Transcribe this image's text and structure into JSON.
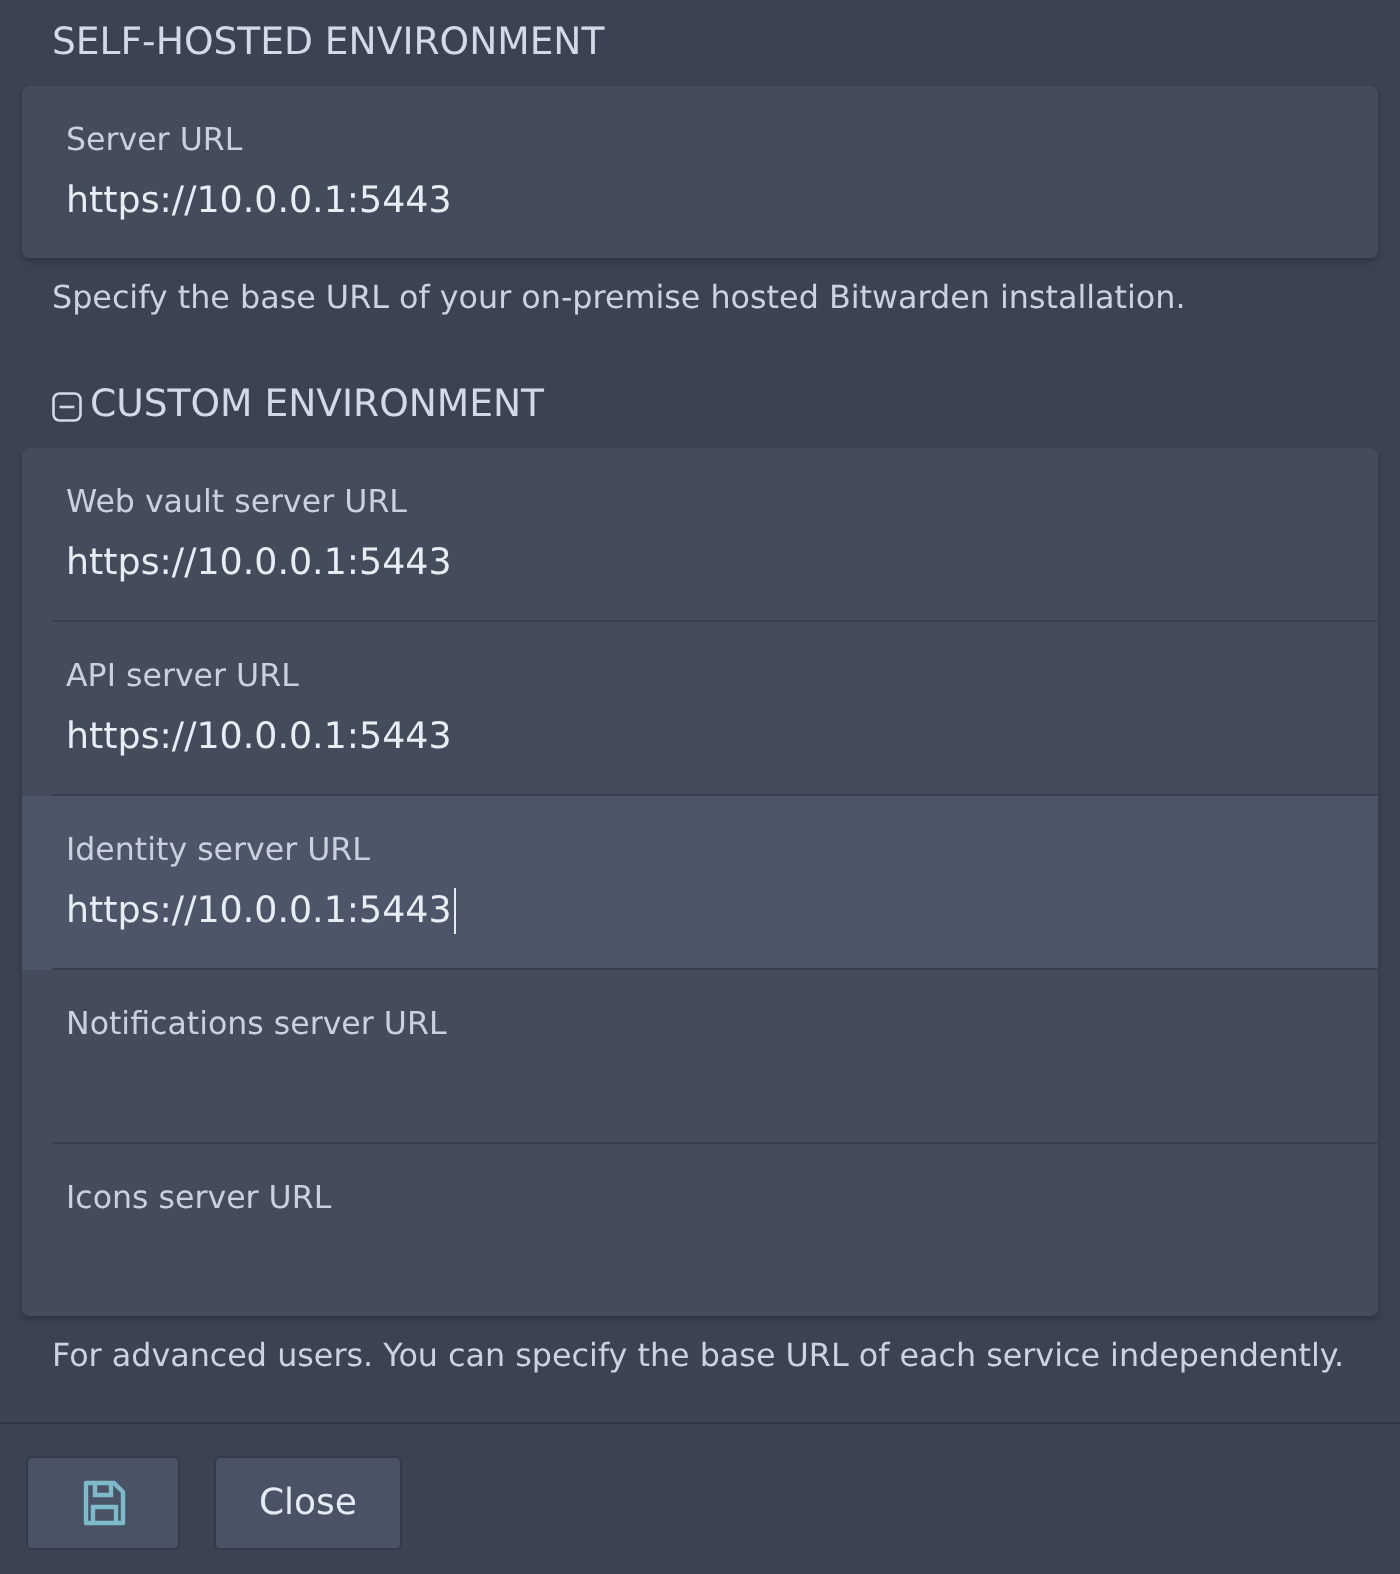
{
  "self_hosted": {
    "heading": "SELF-HOSTED ENVIRONMENT",
    "fields": [
      {
        "label": "Server URL",
        "value": "https://10.0.0.1:5443",
        "focused": false
      }
    ],
    "hint": "Specify the base URL of your on-premise hosted Bitwarden installation."
  },
  "custom": {
    "heading": "CUSTOM ENVIRONMENT",
    "expanded": true,
    "fields": [
      {
        "label": "Web vault server URL",
        "value": "https://10.0.0.1:5443",
        "focused": false
      },
      {
        "label": "API server URL",
        "value": "https://10.0.0.1:5443",
        "focused": false
      },
      {
        "label": "Identity server URL",
        "value": "https://10.0.0.1:5443",
        "focused": true
      },
      {
        "label": "Notifications server URL",
        "focused": false
      },
      {
        "label": "Icons server URL",
        "focused": false
      }
    ],
    "hint": "For advanced users. You can specify the base URL of each service independently."
  },
  "footer": {
    "buttons": [
      {
        "kind": "save"
      },
      {
        "kind": "text",
        "label": "Close"
      }
    ]
  }
}
